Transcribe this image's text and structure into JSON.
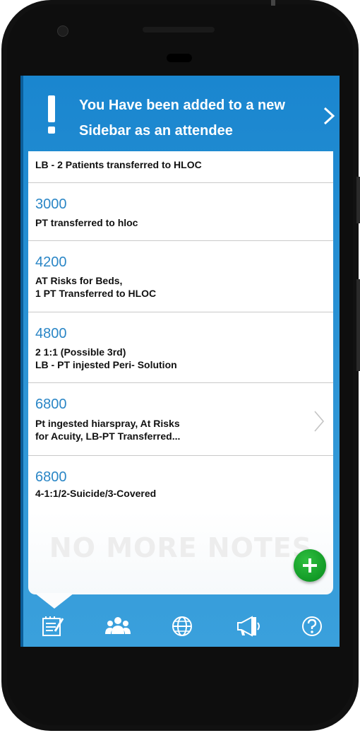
{
  "notice": {
    "text": "You Have been added to a new Sidebar as an attendee",
    "icon": "exclamation-icon",
    "chevron": "chevron-right-icon"
  },
  "notes": [
    {
      "unit": "",
      "text": [
        "LB - 2 Patients transferred to HLOC"
      ]
    },
    {
      "unit": "3000",
      "text": [
        "PT transferred to hloc"
      ]
    },
    {
      "unit": "4200",
      "text": [
        "AT Risks for Beds,",
        "1 PT Transferred to HLOC"
      ]
    },
    {
      "unit": "4800",
      "text": [
        "2 1:1 (Possible 3rd)",
        "LB - PT injested Peri- Solution"
      ]
    },
    {
      "unit": "6800",
      "text": [
        "Pt ingested hiarspray, At Risks",
        "for Acuity, LB-PT Transferred..."
      ]
    },
    {
      "unit": "6800",
      "text": [
        "4-1:1/2-Suicide/3-Covered"
      ]
    }
  ],
  "empty_state": "NO MORE NOTES",
  "fab": {
    "icon": "plus-icon"
  },
  "nav": [
    "notes-icon",
    "people-icon",
    "globe-icon",
    "megaphone-icon",
    "help-icon"
  ],
  "colors": {
    "header_blue": "#1a86cf",
    "accent_blue": "#2a86c6",
    "fab_green": "#129a26"
  }
}
